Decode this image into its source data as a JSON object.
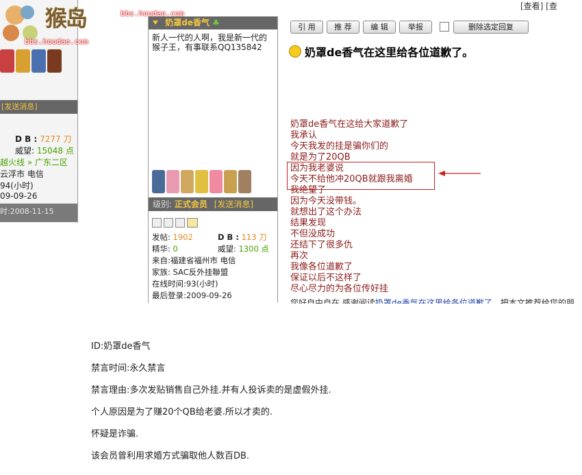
{
  "left_panel": {
    "site_logo_text": "猴岛",
    "site_url": "bbs.houdao.com",
    "send_message": "[发送消息]",
    "db_label": "D B :",
    "db_value": "7277 刀",
    "reputation_label": "威望:",
    "reputation_value": "15048 点",
    "group": "越火线 » 广东二区",
    "city": "云浮市 电信",
    "online": "94(小时)",
    "last_login": "09-09-26",
    "reg_date": "时:2008-11-15"
  },
  "top_right_scrap": "[查看]  [查",
  "sidebar": {
    "username": "奶罩de香气",
    "signature": "新人一代的人啊，我是新一代的猴子王，有事联系QQ135842",
    "level_label": "级别:",
    "level_value": "正式会员",
    "send_message": "[发送消息]",
    "posts_label": "发帖:",
    "posts_value": "1902",
    "db_label": "D B :",
    "db_value": "113 刀",
    "elite_label": "精华:",
    "elite_value": "0",
    "reputation_label": "威望:",
    "reputation_value": "1300 点",
    "from": "来自:福建省福州市 电信",
    "family": "家族: SAC反外挂聯盟",
    "online_time": "在线时间:93(小时)",
    "last_login": "最后登录:2009-09-26"
  },
  "toolbar": {
    "quote": "引 用",
    "recommend": "推 荐",
    "edit": "编 辑",
    "report": "举报",
    "delete_selected": "删除选定回复"
  },
  "post": {
    "title": "奶罩de香气在这里给各位道歉了。",
    "lines": [
      "奶罩de香气在这给大家道歉了",
      "我承认",
      "今天我发的挂是骗你们的",
      "就是为了20QB",
      "因为我老婆说",
      "今天不给他冲20QB就跟我离婚",
      "我绝望了",
      "因为今天没带钱。",
      "就想出了这个办法",
      "结果发现",
      "不但没成功",
      "还结下了很多仇",
      "再次",
      "我像各位道歉了",
      "保证以后不这样了",
      "尽心尽力的为各位传好挂"
    ],
    "teaser_prefix": "您好自由自在,感谢阅读",
    "teaser_link": "奶罩de香气在这里给各位道歉了",
    "teaser_suffix": "。把本文推荐给您的朋"
  },
  "ban_notice": {
    "id_line": "ID:奶罩de香气",
    "ban_time": "禁言时间:永久禁言",
    "ban_reason": "禁言理由:多次发贴销售自己外挂.并有人投诉卖的是虚假外挂.",
    "personal_reason": "个人原因是为了赚20个QB给老婆.所以才卖的.",
    "suspect": "怀疑是诈骗.",
    "history": "该会员曾利用求婚方式骗取他人数百DB."
  },
  "colors": {
    "accent_gold": "#f5c83e",
    "bar_gray": "#666666",
    "post_text": "#8b1c1c",
    "highlight_red": "#c82020"
  }
}
